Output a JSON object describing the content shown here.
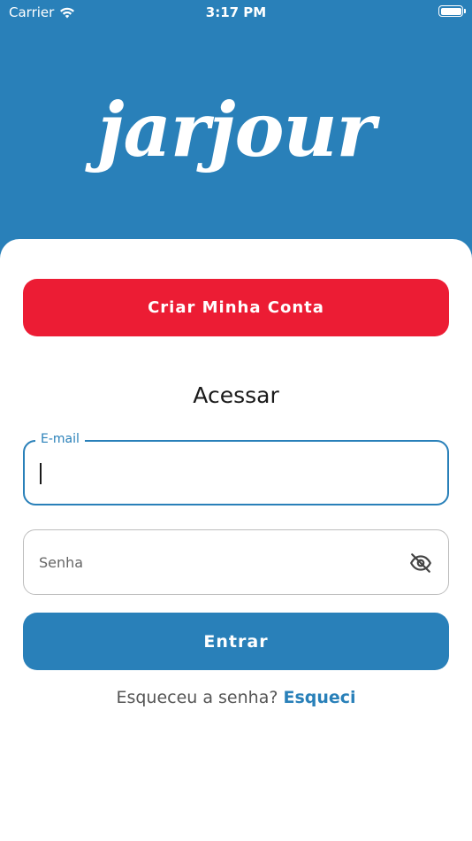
{
  "status_bar": {
    "carrier": "Carrier",
    "time": "3:17 PM",
    "wifi_icon": "wifi-icon",
    "battery_icon": "battery-icon"
  },
  "brand": {
    "logo_text": "jarjour",
    "primary_color": "#2980b9",
    "accent_color": "#ec1c34"
  },
  "actions": {
    "create_account_label": "Criar Minha Conta",
    "login_label": "Entrar"
  },
  "login_section": {
    "title": "Acessar",
    "email": {
      "label": "E-mail",
      "value": ""
    },
    "password": {
      "placeholder": "Senha",
      "value": "",
      "toggle_icon": "eye-off-icon"
    }
  },
  "forgot": {
    "prompt": "Esqueceu a senha?",
    "link": "Esqueci"
  }
}
